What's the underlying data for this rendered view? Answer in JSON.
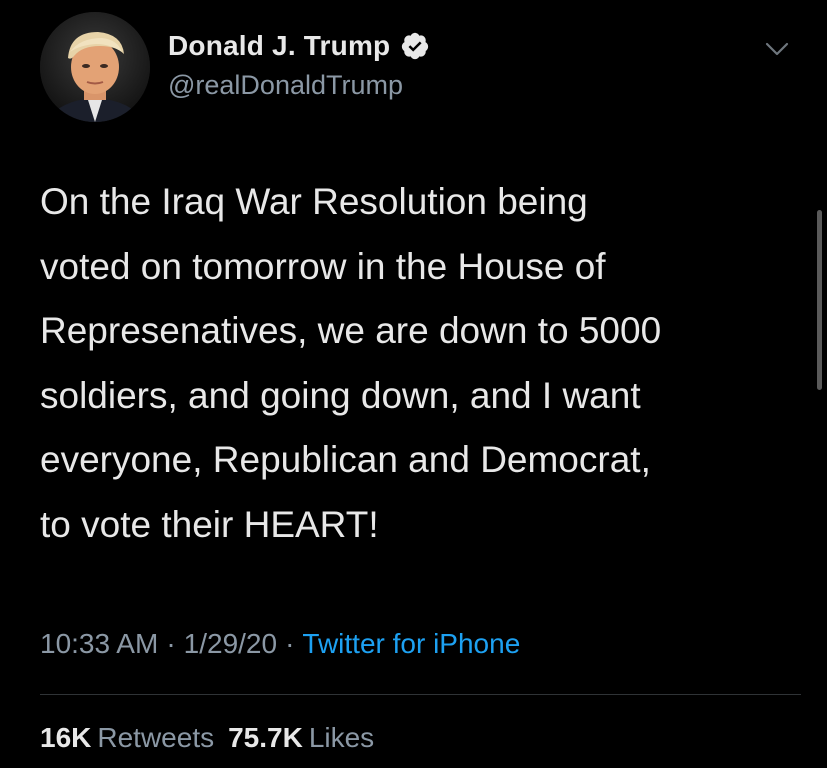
{
  "author": {
    "display_name": "Donald J. Trump",
    "handle": "@realDonaldTrump",
    "verified": true,
    "avatar_icon": "profile-photo"
  },
  "tweet": {
    "lines": [
      "On the Iraq War Resolution being",
      "voted on tomorrow in the House of",
      "Represenatives, we are down to 5000",
      "soldiers, and going down, and I want",
      "everyone, Republican and Democrat,",
      "to vote their HEART!"
    ]
  },
  "meta": {
    "time": "10:33 AM",
    "separator": "·",
    "date": "1/29/20",
    "source": "Twitter for iPhone"
  },
  "stats": {
    "retweets_count": "16K",
    "retweets_label": "Retweets",
    "likes_count": "75.7K",
    "likes_label": "Likes"
  },
  "colors": {
    "background": "#000000",
    "primary_text": "#e8e8e8",
    "secondary_text": "#8b98a5",
    "link": "#1da1f2",
    "verified_badge": "#e8e8e8"
  }
}
